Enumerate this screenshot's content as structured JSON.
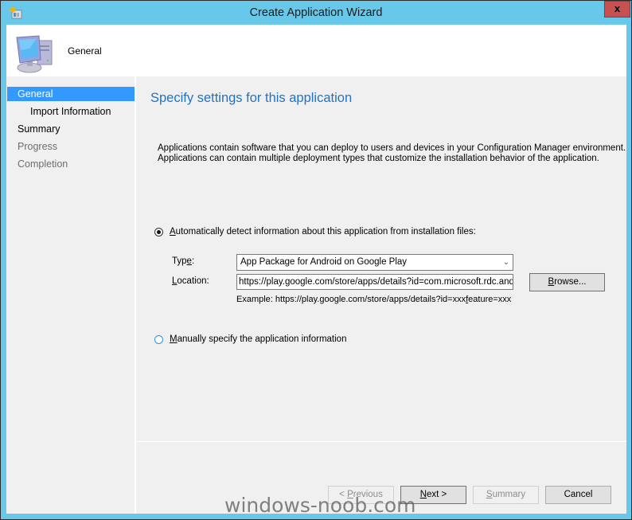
{
  "window": {
    "title": "Create Application Wizard",
    "close_label": "x",
    "app_icon": "wizard-app-icon"
  },
  "header": {
    "icon": "computer-icon",
    "title": "General"
  },
  "sidebar": {
    "items": [
      {
        "label": "General",
        "state": "selected",
        "level": 0
      },
      {
        "label": "Import Information",
        "state": "normal",
        "level": 1
      },
      {
        "label": "Summary",
        "state": "normal",
        "level": 0
      },
      {
        "label": "Progress",
        "state": "disabled",
        "level": 0
      },
      {
        "label": "Completion",
        "state": "disabled",
        "level": 0
      }
    ]
  },
  "content": {
    "title": "Specify settings for this application",
    "description_line1": "Applications contain software that you can deploy to users and devices in your Configuration Manager environment.",
    "description_line2": "Applications can contain multiple deployment types that customize the installation behavior of the application.",
    "option_auto": {
      "mnemonic": "A",
      "label_rest": "utomatically detect information about this application from installation files:",
      "checked": true
    },
    "type_field": {
      "label_pre": "Typ",
      "mnemonic": "e",
      "label_post": ":",
      "value": "App Package for Android on Google Play"
    },
    "location_field": {
      "mnemonic": "L",
      "label_rest": "ocation:",
      "value": "https://play.google.com/store/apps/details?id=com.microsoft.rdc.android"
    },
    "browse_button": {
      "mnemonic": "B",
      "label_rest": "rowse..."
    },
    "example_pre": "Example: https://play.google.com/store/apps/details?id=xxx",
    "example_mnemonic": "f",
    "example_post": "eature=xxx",
    "option_manual": {
      "mnemonic": "M",
      "label_rest": "anually specify the application information",
      "checked": false
    }
  },
  "footer": {
    "previous": {
      "pre": "< ",
      "mnemonic": "P",
      "rest": "revious",
      "enabled": false
    },
    "next": {
      "mnemonic": "N",
      "rest": "ext >",
      "enabled": true
    },
    "summary": {
      "mnemonic": "S",
      "rest": "ummary",
      "enabled": false
    },
    "cancel": {
      "label": "Cancel",
      "enabled": true
    }
  },
  "watermark": "windows-noob.com"
}
